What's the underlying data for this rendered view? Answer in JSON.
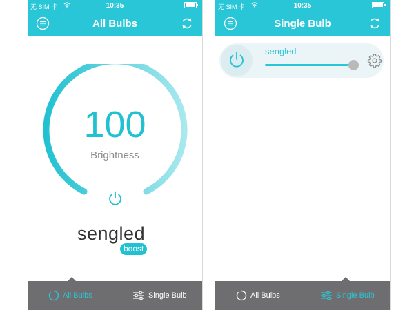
{
  "status_bar": {
    "carrier": "无 SIM 卡",
    "time": "10:35"
  },
  "icons": {
    "menu": "menu-circle-icon",
    "refresh": "refresh-icon",
    "power": "power-icon",
    "wifi": "wifi-icon",
    "battery": "battery-icon",
    "settings": "gear-icon",
    "all_bulbs_tab": "circle-icon",
    "single_bulb_tab": "sliders-icon"
  },
  "colors": {
    "accent": "#29c6d8",
    "tab_bar": "#6e6e70",
    "dial_track_end": "#a8e8ee"
  },
  "all_bulbs_screen": {
    "title": "All Bulbs",
    "brightness_value": "100",
    "brightness_label": "Brightness",
    "brightness_level": 1.0,
    "logo": {
      "wordmark": "sengled",
      "badge": "boost"
    }
  },
  "single_bulb_screen": {
    "title": "Single Bulb",
    "bulb": {
      "name": "sengled",
      "brightness_level": 1.0
    }
  },
  "tabs": {
    "all_bulbs": "All Bulbs",
    "single_bulb": "Single Bulb"
  }
}
